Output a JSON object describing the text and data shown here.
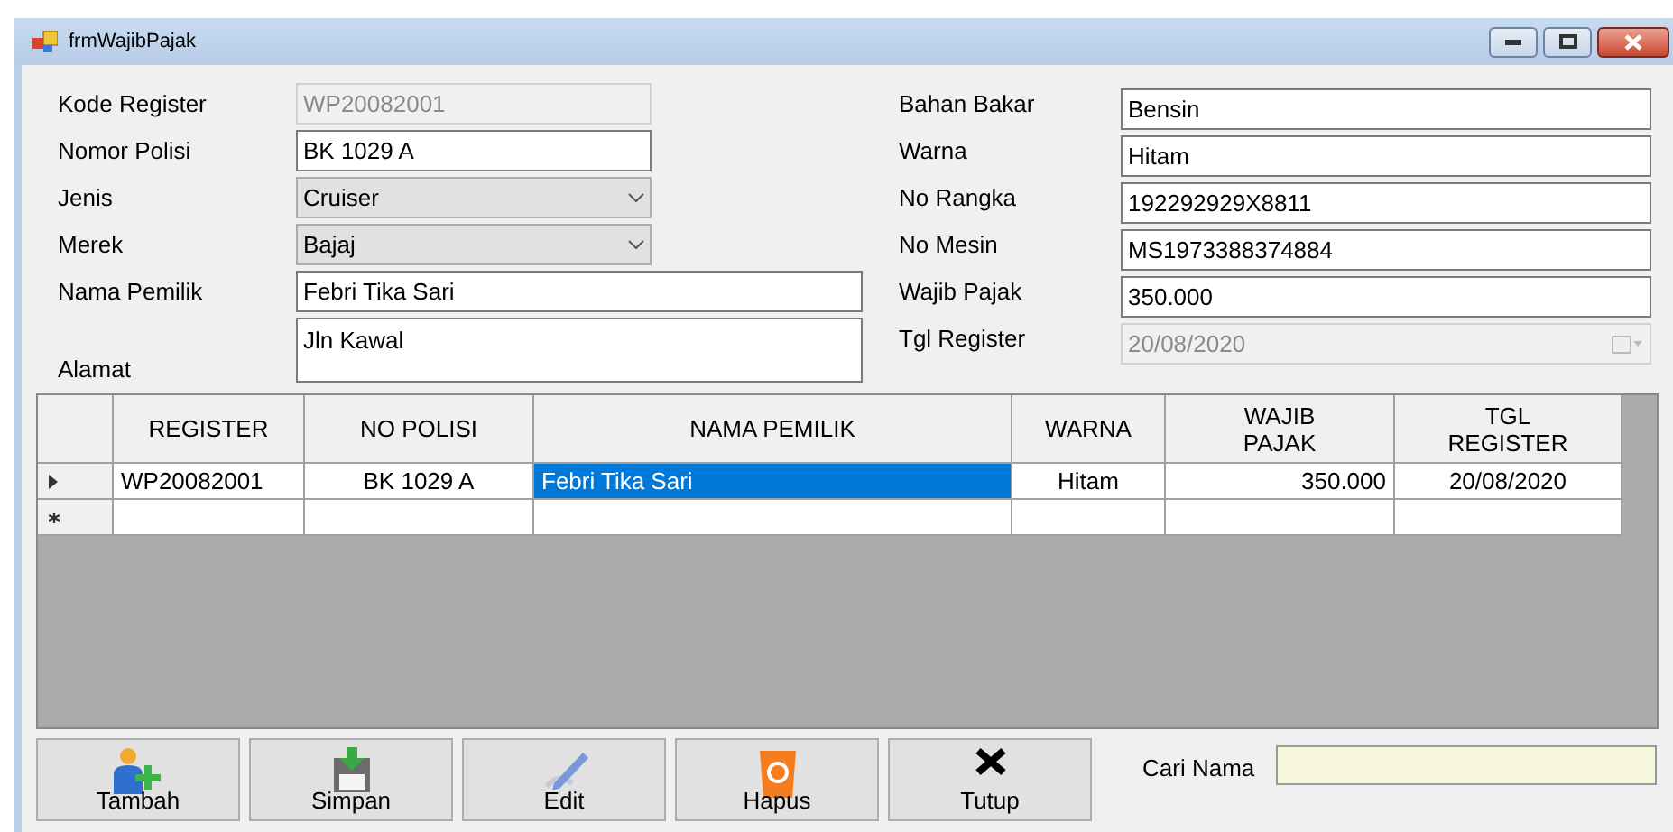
{
  "window": {
    "title": "frmWajibPajak"
  },
  "left_fields": [
    {
      "label": "Kode Register",
      "value": "WP20082001",
      "kind": "text",
      "disabled": true,
      "wide": false
    },
    {
      "label": "Nomor Polisi",
      "value": "BK 1029 A",
      "kind": "text",
      "disabled": false,
      "wide": false
    },
    {
      "label": "Jenis",
      "value": "Cruiser",
      "kind": "combo",
      "disabled": false,
      "wide": false
    },
    {
      "label": "Merek",
      "value": "Bajaj",
      "kind": "combo",
      "disabled": false,
      "wide": false
    },
    {
      "label": "Nama Pemilik",
      "value": "Febri Tika Sari",
      "kind": "text",
      "disabled": false,
      "wide": true
    },
    {
      "label": "Alamat",
      "value": "Jln Kawal",
      "kind": "multiline",
      "disabled": false,
      "wide": true
    }
  ],
  "right_fields": [
    {
      "label": "Bahan Bakar",
      "value": "Bensin",
      "kind": "text",
      "disabled": false
    },
    {
      "label": "Warna",
      "value": "Hitam",
      "kind": "text",
      "disabled": false
    },
    {
      "label": "No Rangka",
      "value": "192292929X8811",
      "kind": "text",
      "disabled": false
    },
    {
      "label": "No Mesin",
      "value": "MS1973388374884",
      "kind": "text",
      "disabled": false
    },
    {
      "label": "Wajib Pajak",
      "value": "350.000",
      "kind": "text",
      "disabled": false
    },
    {
      "label": "Tgl Register",
      "value": "20/08/2020",
      "kind": "date",
      "disabled": true
    }
  ],
  "table": {
    "columns": [
      "REGISTER",
      "NO POLISI",
      "NAMA PEMILIK",
      "WARNA",
      "WAJIB PAJAK",
      "TGL REGISTER"
    ],
    "rows": [
      {
        "kind": "current",
        "cells": [
          {
            "text": "WP20082001",
            "selected": false
          },
          {
            "text": "BK 1029 A",
            "selected": false
          },
          {
            "text": "Febri Tika Sari",
            "selected": true
          },
          {
            "text": "Hitam",
            "selected": false
          },
          {
            "text": "350.000",
            "selected": false
          },
          {
            "text": "20/08/2020",
            "selected": false
          }
        ]
      },
      {
        "kind": "new",
        "cells": [
          {
            "text": "",
            "selected": false
          },
          {
            "text": "",
            "selected": false
          },
          {
            "text": "",
            "selected": false
          },
          {
            "text": "",
            "selected": false
          },
          {
            "text": "",
            "selected": false
          },
          {
            "text": "",
            "selected": false
          }
        ]
      }
    ]
  },
  "buttons": [
    {
      "label": "Tambah",
      "kind": "add"
    },
    {
      "label": "Simpan",
      "kind": "save"
    },
    {
      "label": "Edit",
      "kind": "edit"
    },
    {
      "label": "Hapus",
      "kind": "delete"
    },
    {
      "label": "Tutup",
      "kind": "close"
    }
  ],
  "search": {
    "label": "Cari Nama"
  }
}
